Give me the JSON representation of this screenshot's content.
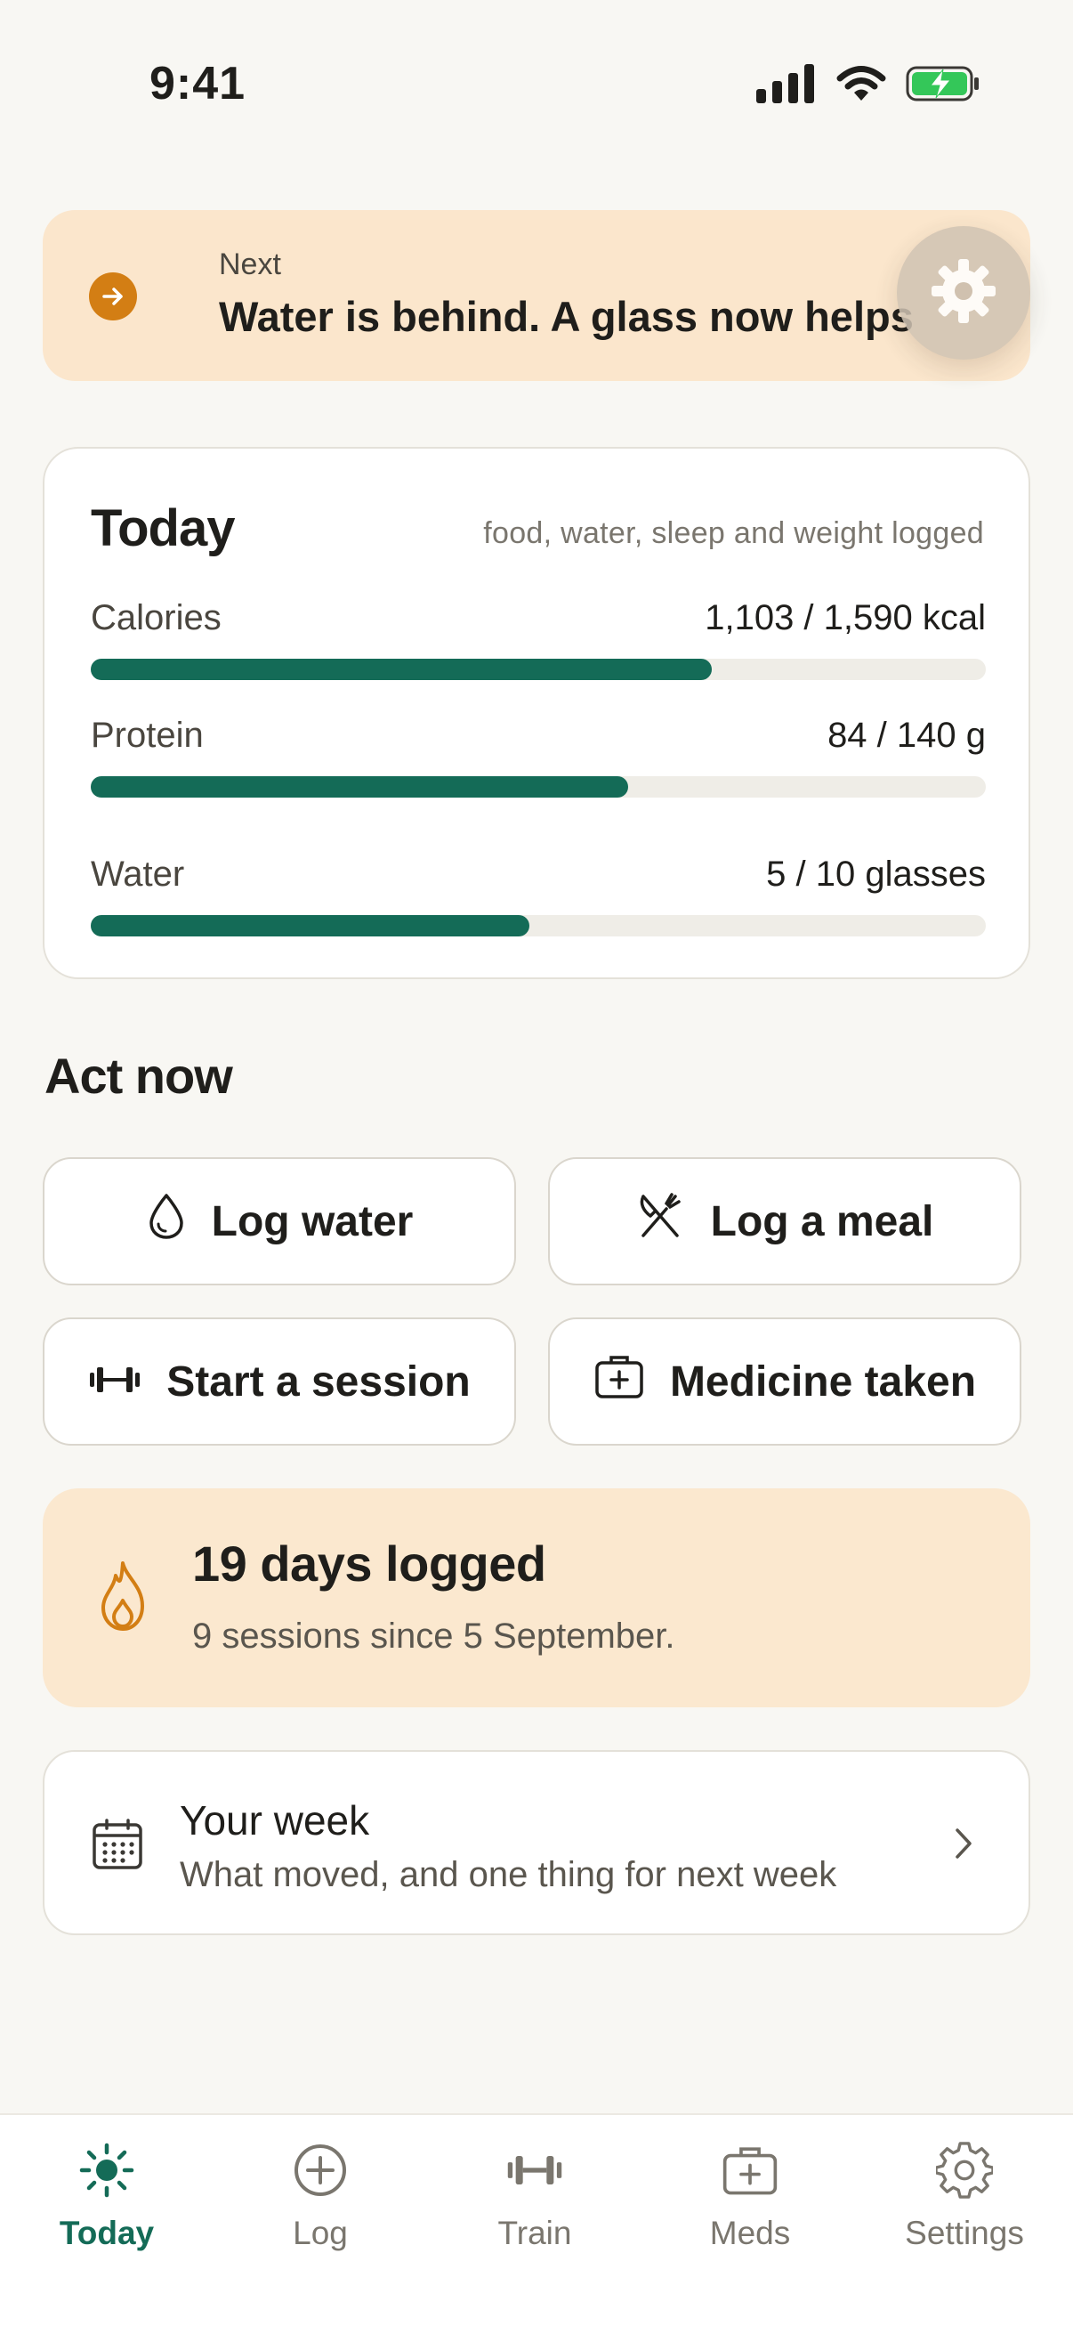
{
  "status_bar": {
    "time": "9:41"
  },
  "next_banner": {
    "label": "Next",
    "text": "Water is behind. A glass now helps"
  },
  "today": {
    "title": "Today",
    "subtitle": "food, water, sleep and weight logged",
    "metrics": [
      {
        "label": "Calories",
        "value": "1,103 / 1,590 kcal",
        "progress": 0.694
      },
      {
        "label": "Protein",
        "value": "84 / 140 g",
        "progress": 0.6
      },
      {
        "label": "Water",
        "value": "5 / 10 glasses",
        "progress": 0.49
      }
    ]
  },
  "act_now": {
    "title": "Act now",
    "actions": [
      {
        "label": "Log water",
        "icon": "droplet-icon"
      },
      {
        "label": "Log a meal",
        "icon": "fork-knife-icon"
      },
      {
        "label": "Start a session",
        "icon": "dumbbell-icon"
      },
      {
        "label": "Medicine taken",
        "icon": "medical-kit-icon"
      }
    ]
  },
  "streak": {
    "title": "19 days logged",
    "subtitle": "9 sessions since 5 September.",
    "icon": "flame-icon"
  },
  "week": {
    "title": "Your week",
    "subtitle": "What moved, and one thing for next week",
    "icon": "calendar-icon"
  },
  "tabs": [
    {
      "label": "Today",
      "icon": "sun-icon",
      "active": true
    },
    {
      "label": "Log",
      "icon": "plus-circle-icon",
      "active": false
    },
    {
      "label": "Train",
      "icon": "dumbbell-icon",
      "active": false
    },
    {
      "label": "Meds",
      "icon": "medical-kit-icon",
      "active": false
    },
    {
      "label": "Settings",
      "icon": "gear-icon",
      "active": false
    }
  ],
  "colors": {
    "accent": "#146B57",
    "banner": "#FBE6CC",
    "warning_orange": "#D37E14",
    "background": "#F8F7F3"
  }
}
